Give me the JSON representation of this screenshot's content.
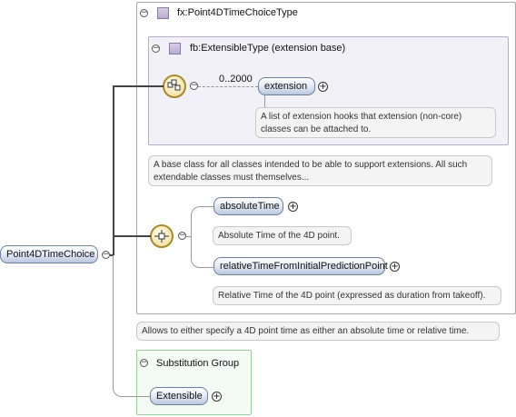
{
  "root_element": {
    "name": "Point4DTimeChoice",
    "toggle": "−"
  },
  "complex_type": {
    "name": "fx:Point4DTimeChoiceType",
    "toggle": "−"
  },
  "extension_base": {
    "name": "fb:ExtensibleType (extension base)",
    "toggle": "−"
  },
  "extension_sequence": {
    "cardinality": "0..2000",
    "element": "extension",
    "expand": "+",
    "doc": "A list of extension hooks that extension (non-core) classes can be attached to.",
    "toggle": "−"
  },
  "type_doc": "A base class for all classes intended to be able to support extensions. All such extendable classes must themselves...",
  "choice": {
    "toggle": "−",
    "items": [
      {
        "name": "absoluteTime",
        "expand": "+",
        "doc": "Absolute Time of the 4D point."
      },
      {
        "name": "relativeTimeFromInitialPredictionPoint",
        "expand": "+",
        "doc": "Relative Time of the 4D point (expressed as duration from takeoff)."
      }
    ]
  },
  "element_doc": "Allows to either specify a 4D point time as either an absolute time or relative time.",
  "substitution_group": {
    "title": "Substitution Group",
    "toggle": "−",
    "member": "Extensible",
    "expand": "+"
  },
  "colors": {
    "node_border": "#6d7f9a",
    "node_fill": "#b9c8df",
    "compositor_border": "#a88a2c",
    "inner_box": "#f3f1f8"
  }
}
